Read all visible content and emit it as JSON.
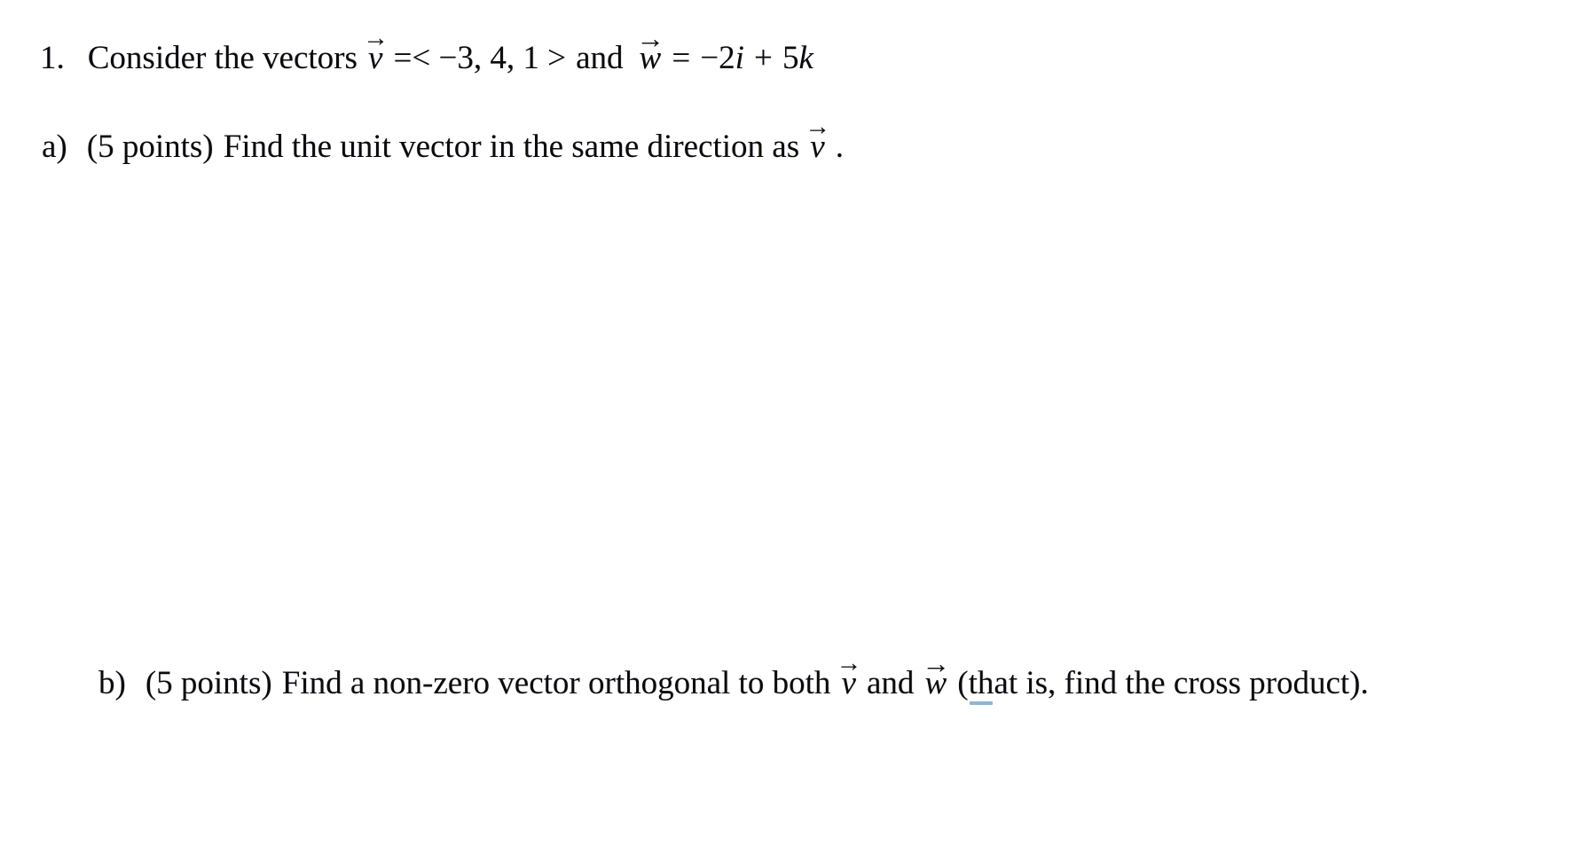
{
  "document": {
    "background_color": "#ffffff",
    "text_color": "#0b0b0b",
    "artifact_underline_color": "#8fb4d4"
  },
  "question": {
    "number": "1.",
    "stem_before_v": "Consider the vectors",
    "v_symbol": "v",
    "v_arrow": "→",
    "v_definition": "=< −3, 4, 1 >",
    "conjunction": "and",
    "w_symbol": "w",
    "w_arrow": "→",
    "w_equals": "=",
    "w_term1": "−2",
    "w_unit1": "i",
    "w_plus": "+",
    "w_term2": "5",
    "w_unit2": "k",
    "full_text": "1. Consider the vectors v⃗ =< −3, 4, 1 > and w⃗ = −2i + 5k"
  },
  "parts": [
    {
      "label": "a)",
      "points": "(5 points)",
      "prompt_before_vec": "Find the unit vector in the same direction as",
      "vec_symbol": "v",
      "vec_arrow": "→",
      "trailing": ".",
      "full_text": "a) (5 points) Find the unit vector in the same direction as v⃗ ."
    },
    {
      "label": "b)",
      "points": "(5 points)",
      "prompt_before_v": "Find a non-zero vector orthogonal to both",
      "vec_symbol_v": "v",
      "vec_arrow_v": "→",
      "conjunction": "and",
      "vec_symbol_w": "w",
      "vec_arrow_w": "→",
      "paren_open": "(",
      "misspelled_fragment": "th",
      "rest_of_word": "at",
      "trailing": " is, find the cross product).",
      "full_text": "b) (5 points) Find a non-zero vector orthogonal to both v⃗ and w⃗ (that is, find the cross product)."
    }
  ],
  "answer_spaces": [
    {
      "name": "answer-space-a",
      "hint": "blank work area below part a"
    },
    {
      "name": "answer-space-b",
      "hint": "blank work area below part b"
    }
  ]
}
